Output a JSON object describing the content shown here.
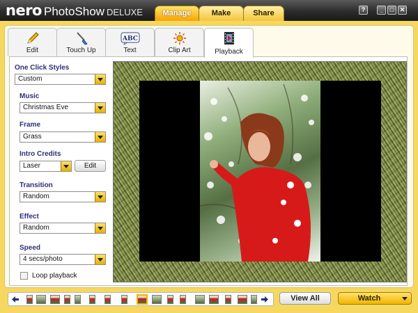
{
  "app": {
    "brand": "nero",
    "product": "PhotoShow",
    "edition": "DELUXE"
  },
  "main_tabs": [
    {
      "label": "Manage",
      "active": true
    },
    {
      "label": "Make",
      "active": false
    },
    {
      "label": "Share",
      "active": false
    }
  ],
  "window_buttons": {
    "help": "?",
    "minimize": "_",
    "restore": "□",
    "close": "✕"
  },
  "tool_tabs": [
    {
      "label": "Edit",
      "icon": "pencil-icon"
    },
    {
      "label": "Touch Up",
      "icon": "brush-icon"
    },
    {
      "label": "Text",
      "icon": "abc-text-icon",
      "icon_text": "ABC"
    },
    {
      "label": "Clip Art",
      "icon": "sun-clipart-icon"
    },
    {
      "label": "Playback",
      "icon": "filmstrip-icon",
      "active": true
    }
  ],
  "settings": {
    "one_click_styles": {
      "label": "One Click Styles",
      "value": "Custom"
    },
    "music": {
      "label": "Music",
      "value": "Christmas Eve"
    },
    "frame": {
      "label": "Frame",
      "value": "Grass"
    },
    "intro_credits": {
      "label": "Intro Credits",
      "value": "Laser",
      "edit_label": "Edit"
    },
    "transition": {
      "label": "Transition",
      "value": "Random"
    },
    "effect": {
      "label": "Effect",
      "value": "Random"
    },
    "speed": {
      "label": "Speed",
      "value": "4 secs/photo"
    },
    "loop_playback": {
      "label": "Loop playback",
      "checked": false
    }
  },
  "bottom": {
    "view_all_label": "View All",
    "watch_label": "Watch"
  },
  "colors": {
    "accent": "#f7b500",
    "band": "#f6d860",
    "section_label": "#2e2e7a",
    "dress_red": "#d61a1a"
  }
}
